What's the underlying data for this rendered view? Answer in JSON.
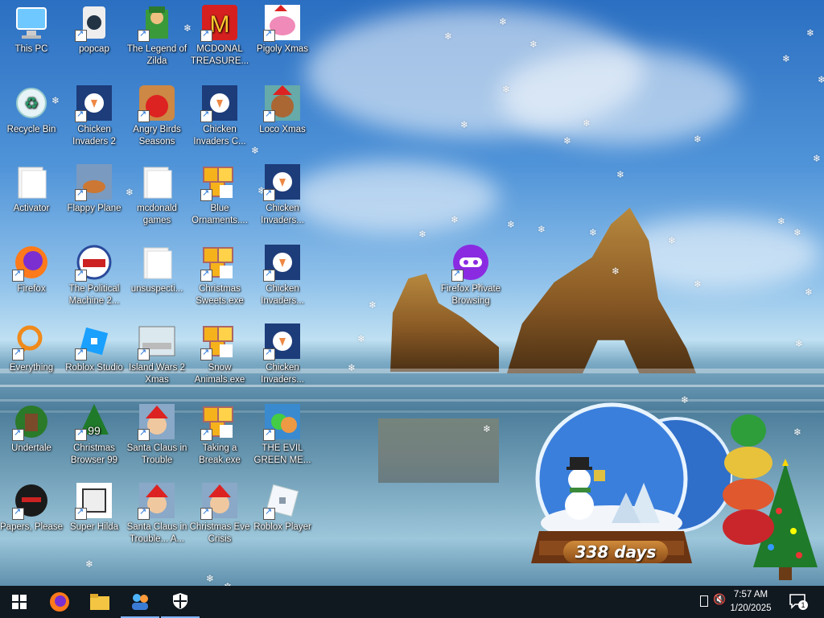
{
  "desktop_icons": [
    {
      "label": "This PC",
      "icon": "this-pc-icon"
    },
    {
      "label": "popcap",
      "icon": "popcap-icon"
    },
    {
      "label": "The Legend of Zilda",
      "icon": "zilda-icon"
    },
    {
      "label": "MCDONAL TREASURE...",
      "icon": "mcdonalds-icon"
    },
    {
      "label": "Pigoly Xmas",
      "icon": "pigoly-icon"
    },
    {
      "label": "Recycle Bin",
      "icon": "recycle-bin-icon"
    },
    {
      "label": "Chicken Invaders 2",
      "icon": "chicken-invaders-icon"
    },
    {
      "label": "Angry Birds Seasons",
      "icon": "angry-birds-icon"
    },
    {
      "label": "Chicken Invaders C...",
      "icon": "chicken-invaders-icon"
    },
    {
      "label": "Loco Xmas",
      "icon": "loco-xmas-icon"
    },
    {
      "label": "Activator",
      "icon": "folder-icon"
    },
    {
      "label": "Flappy Plane",
      "icon": "flappy-plane-icon"
    },
    {
      "label": "mcdonald games",
      "icon": "folder-icon"
    },
    {
      "label": "Blue Ornaments....",
      "icon": "puzzle-icon"
    },
    {
      "label": "Chicken Invaders...",
      "icon": "chicken-invaders-icon"
    },
    {
      "label": "Firefox",
      "icon": "firefox-icon"
    },
    {
      "label": "The Political Machine 2...",
      "icon": "political-machine-icon"
    },
    {
      "label": "unsuspecti...",
      "icon": "folder-icon"
    },
    {
      "label": "Christmas Sweets.exe",
      "icon": "puzzle-icon"
    },
    {
      "label": "Chicken Invaders...",
      "icon": "chicken-invaders-icon"
    },
    {
      "label": "Everything",
      "icon": "everything-search-icon"
    },
    {
      "label": "Roblox Studio",
      "icon": "roblox-studio-icon"
    },
    {
      "label": "Island Wars 2 Xmas",
      "icon": "island-wars-icon"
    },
    {
      "label": "Snow Animals.exe",
      "icon": "puzzle-icon"
    },
    {
      "label": "Chicken Invaders...",
      "icon": "chicken-invaders-icon"
    },
    {
      "label": "Undertale",
      "icon": "undertale-icon"
    },
    {
      "label": "Christmas Browser 99",
      "icon": "christmas-tree-icon"
    },
    {
      "label": "Santa Claus in Trouble",
      "icon": "santa-icon"
    },
    {
      "label": "Taking a Break.exe",
      "icon": "puzzle-icon"
    },
    {
      "label": "THE EVIL GREEN ME...",
      "icon": "evil-green-icon"
    },
    {
      "label": "Papers, Please",
      "icon": "papers-please-icon"
    },
    {
      "label": "Super Hilda",
      "icon": "super-hilda-icon"
    },
    {
      "label": "Santa Claus in Trouble... A...",
      "icon": "santa-icon"
    },
    {
      "label": "Christmas Eve Crisis",
      "icon": "santa-icon"
    },
    {
      "label": "Roblox Player",
      "icon": "roblox-player-icon"
    },
    {
      "label": "Firefox Private Browsing",
      "icon": "firefox-private-icon"
    }
  ],
  "countdown_widget": {
    "days_text": "338 days"
  },
  "taskbar": {
    "clock_time": "7:57 AM",
    "clock_date": "1/20/2025",
    "notification_count": "1",
    "items": [
      {
        "name": "start-button",
        "icon": "windows-logo-icon"
      },
      {
        "name": "taskbar-firefox",
        "icon": "firefox-icon"
      },
      {
        "name": "taskbar-file-explorer",
        "icon": "folder-icon"
      },
      {
        "name": "taskbar-app-people",
        "icon": "people-icon"
      },
      {
        "name": "taskbar-security",
        "icon": "shield-icon"
      }
    ]
  },
  "colors": {
    "taskbar": "#101820",
    "accent": "#7fb3ff"
  }
}
